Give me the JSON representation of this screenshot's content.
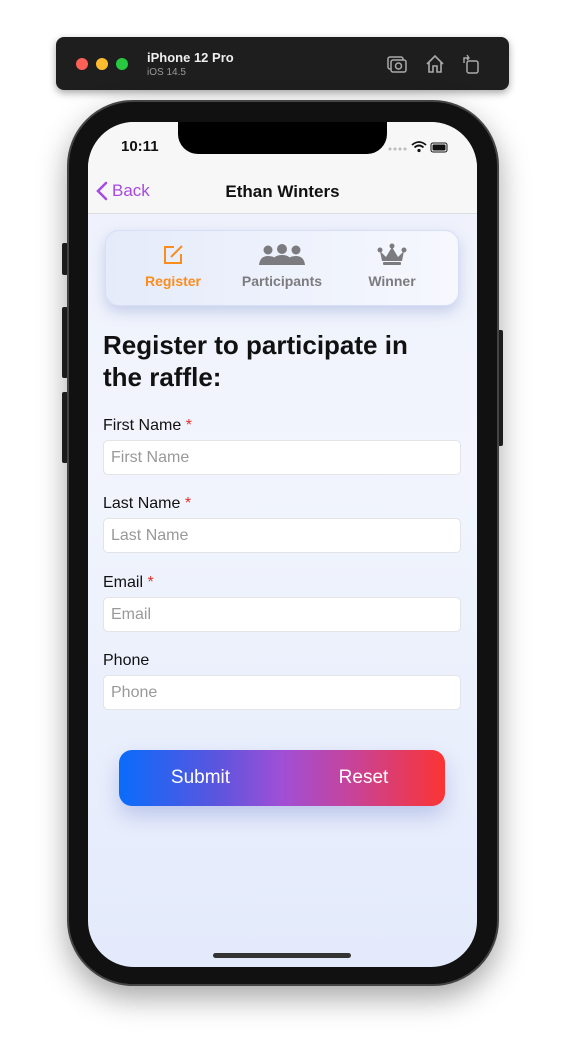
{
  "simulator": {
    "device": "iPhone 12 Pro",
    "os": "iOS 14.5",
    "icons": [
      "screenshot-icon",
      "home-icon",
      "rotate-icon"
    ]
  },
  "status": {
    "time": "10:11"
  },
  "nav": {
    "back_label": "Back",
    "title": "Ethan Winters"
  },
  "tabs": [
    {
      "label": "Register",
      "icon": "edit-icon",
      "active": true
    },
    {
      "label": "Participants",
      "icon": "people-icon",
      "active": false
    },
    {
      "label": "Winner",
      "icon": "crown-icon",
      "active": false
    }
  ],
  "form": {
    "heading": "Register to participate in the raffle:",
    "fields": [
      {
        "label": "First Name",
        "required": "*",
        "placeholder": "First Name"
      },
      {
        "label": "Last Name",
        "required": "*",
        "placeholder": "Last Name"
      },
      {
        "label": "Email",
        "required": "*",
        "placeholder": "Email"
      },
      {
        "label": "Phone",
        "placeholder": "Phone"
      }
    ],
    "submit": "Submit",
    "reset": "Reset"
  },
  "colors": {
    "accent": "#a64be0",
    "active_tab": "#fb8c1e",
    "required": "#e0302a"
  }
}
